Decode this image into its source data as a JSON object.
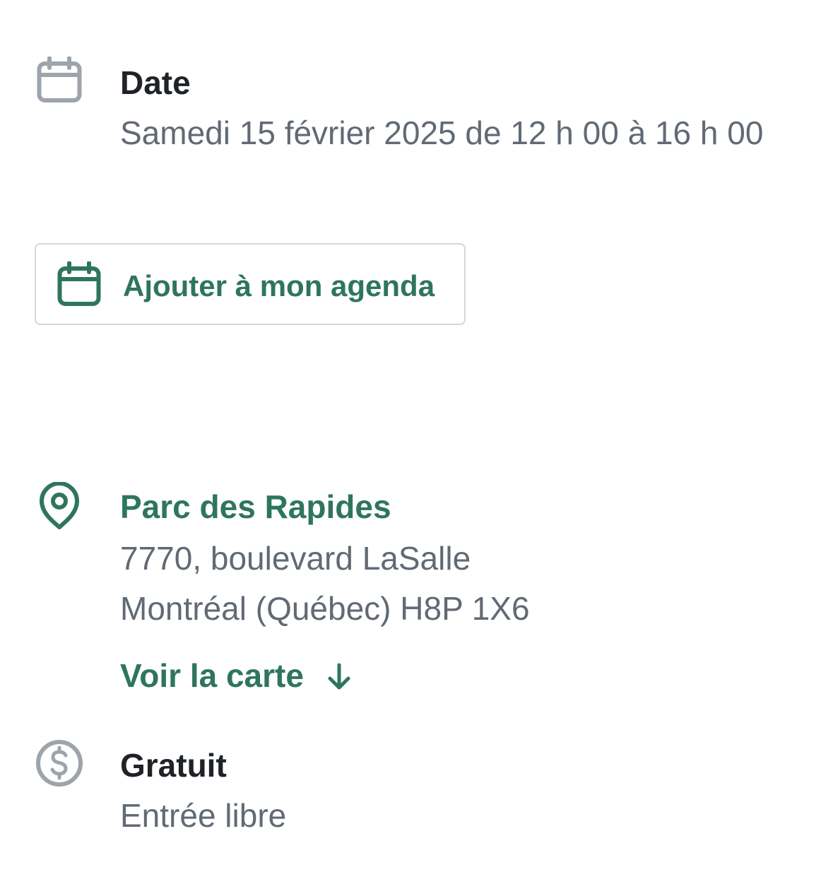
{
  "date_section": {
    "icon": "calendar-icon",
    "title": "Date",
    "value": "Samedi 15 février 2025 de 12 h 00 à 16 h 00"
  },
  "agenda_button": {
    "icon": "calendar-icon",
    "label": "Ajouter à mon agenda"
  },
  "location_section": {
    "icon": "map-pin-icon",
    "name": "Parc des Rapides",
    "address_line1": "7770, boulevard LaSalle",
    "address_line2": "Montréal (Québec) H8P 1X6",
    "map_link_label": "Voir la carte",
    "map_link_icon": "arrow-down-icon"
  },
  "price_section": {
    "icon": "dollar-circle-icon",
    "title": "Gratuit",
    "value": "Entrée libre"
  },
  "colors": {
    "accent": "#2e7560",
    "heading": "#1f2327",
    "body_text": "#616a74",
    "icon_gray": "#9ea4ab",
    "border": "#d4d8dc"
  }
}
